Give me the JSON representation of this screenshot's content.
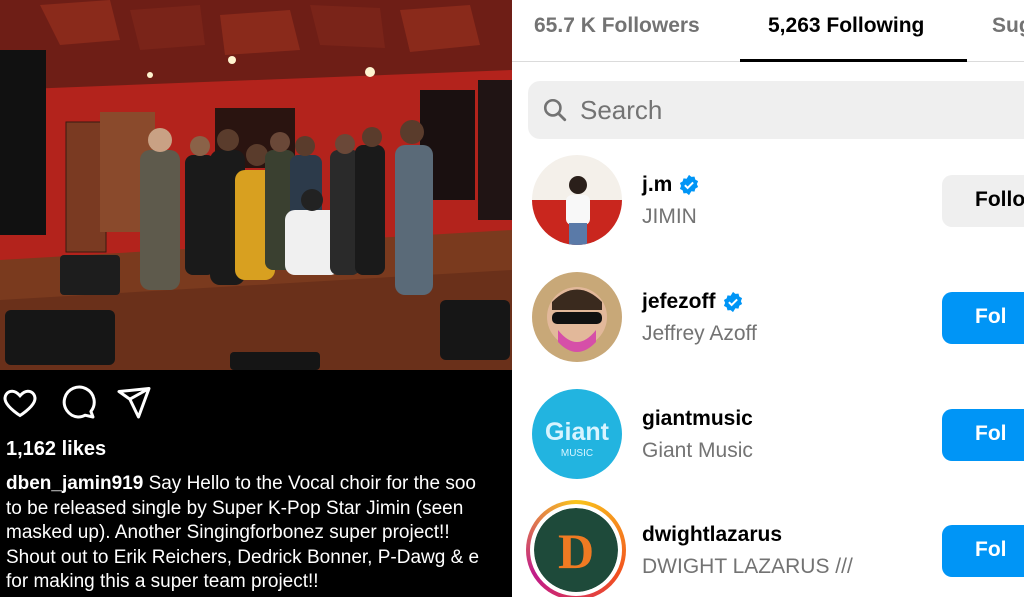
{
  "post": {
    "likes": "1,162 likes",
    "username": "dben_jamin919",
    "caption_lines": [
      "Say Hello to the Vocal choir for the soo",
      "to be released single by Super K-Pop Star Jimin (seen",
      "masked up). Another Singingforbonez super project!!",
      "Shout out to Erik Reichers, Dedrick Bonner, P-Dawg & e",
      "for making this a super team project!!"
    ],
    "icons": [
      "heart-icon",
      "comment-icon",
      "share-icon"
    ]
  },
  "profile": {
    "tabs": [
      {
        "label": "65.7 K Followers",
        "active": false
      },
      {
        "label": "5,263 Following",
        "active": true
      },
      {
        "label": "Sug",
        "active": false
      }
    ],
    "search": {
      "placeholder": "Search"
    },
    "accounts": [
      {
        "username": "j.m",
        "full_name": "JIMIN",
        "verified": true,
        "button": "Follo",
        "button_style": "secondary"
      },
      {
        "username": "jefezoff",
        "full_name": "Jeffrey Azoff",
        "verified": true,
        "button": "Fol",
        "button_style": "primary"
      },
      {
        "username": "giantmusic",
        "full_name": "Giant Music",
        "verified": false,
        "button": "Fol",
        "button_style": "primary",
        "avatar_text": [
          "Giant",
          "MUSIC"
        ]
      },
      {
        "username": "dwightlazarus",
        "full_name": "DWIGHT LAZARUS ///",
        "verified": false,
        "button": "Fol",
        "button_style": "primary",
        "avatar_text": [
          "D"
        ]
      }
    ]
  },
  "colors": {
    "accent": "#0095f6",
    "secondary_text": "#737373",
    "search_bg": "#efefef"
  }
}
